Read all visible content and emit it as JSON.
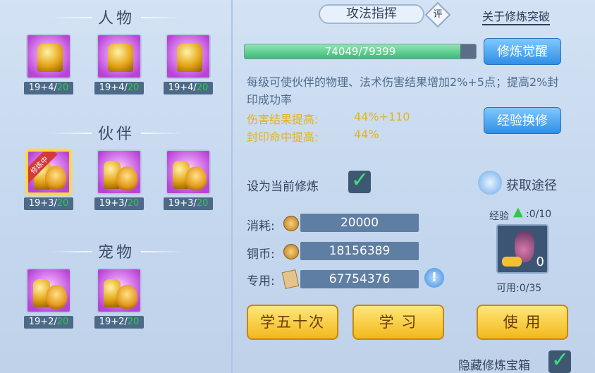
{
  "sections": [
    {
      "title": "人物",
      "slots": [
        {
          "icon": "meditating-warrior-icon",
          "level": "19+4/",
          "max": "20",
          "selected": false
        },
        {
          "icon": "shield-warrior-icon",
          "level": "19+4/",
          "max": "20",
          "selected": false
        },
        {
          "icon": "armored-warrior-icon",
          "level": "19+4/",
          "max": "20",
          "selected": false
        }
      ]
    },
    {
      "title": "伙伴",
      "slots": [
        {
          "icon": "sword-lion-icon",
          "level": "19+3/",
          "max": "20",
          "selected": true,
          "badge": "修炼中"
        },
        {
          "icon": "shield-lion-icon",
          "level": "19+3/",
          "max": "20",
          "selected": false
        },
        {
          "icon": "palm-lion-icon",
          "level": "19+3/",
          "max": "20",
          "selected": false
        }
      ]
    },
    {
      "title": "宠物",
      "slots": [
        {
          "icon": "sword-cat-icon",
          "level": "19+2/",
          "max": "20",
          "selected": false
        },
        {
          "icon": "shield-cat-icon",
          "level": "19+2/",
          "max": "20",
          "selected": false
        }
      ]
    }
  ],
  "header": {
    "tab": "攻法指挥",
    "rate_label": "评",
    "about_link": "关于修炼突破"
  },
  "progress": {
    "text": "74049/79399",
    "current": 74049,
    "max": 79399
  },
  "buttons": {
    "awaken": "修炼觉醒",
    "exchange": "经验换修",
    "learn50": "学五十次",
    "learn": "学 习",
    "use": "使 用"
  },
  "description": "每级可使伙伴的物理、法术伤害结果增加2%+5点；提高2%封印成功率",
  "bonus": [
    {
      "label": "伤害结果提高:",
      "value": "44%+110"
    },
    {
      "label": "封印命中提高:",
      "value": "44%"
    }
  ],
  "set_current": {
    "label": "设为当前修炼",
    "checked": true
  },
  "acquire": "获取途径",
  "costs": [
    {
      "label": "消耗:",
      "value": "20000",
      "icon": "coin-icon"
    },
    {
      "label": "铜币:",
      "value": "18156389",
      "icon": "coin-icon"
    },
    {
      "label": "专用:",
      "value": "67754376",
      "icon": "scroll-icon"
    }
  ],
  "exp": {
    "label": "经验",
    "value": ":0/10"
  },
  "item": {
    "icon": "vase-icon",
    "count": "0",
    "usable": "可用:0/35"
  },
  "hide_box": {
    "label": "隐藏修炼宝箱",
    "checked": true
  },
  "colors": {
    "accent_gold": "#e5b319",
    "tile_purple": "#b843d6",
    "progress_green": "#3db97a"
  }
}
